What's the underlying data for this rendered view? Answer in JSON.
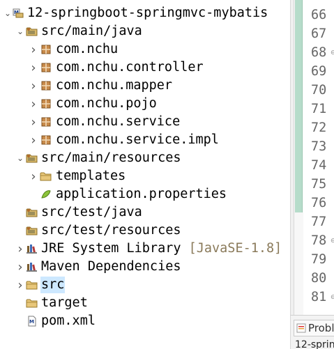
{
  "project_explorer": {
    "rows": [
      {
        "name": "project-root",
        "label": "12-springboot-springmvc-mybatis",
        "icon": "maven-project-icon",
        "expanded": true
      },
      {
        "name": "src-main-java",
        "label": "src/main/java",
        "icon": "source-folder-icon",
        "expanded": true
      },
      {
        "name": "pkg-com-nchu",
        "label": "com.nchu",
        "icon": "package-icon",
        "expanded": false
      },
      {
        "name": "pkg-controller",
        "label": "com.nchu.controller",
        "icon": "package-icon",
        "expanded": false
      },
      {
        "name": "pkg-mapper",
        "label": "com.nchu.mapper",
        "icon": "package-icon",
        "expanded": false
      },
      {
        "name": "pkg-pojo",
        "label": "com.nchu.pojo",
        "icon": "package-icon",
        "expanded": false
      },
      {
        "name": "pkg-service",
        "label": "com.nchu.service",
        "icon": "package-icon",
        "expanded": false
      },
      {
        "name": "pkg-service-impl",
        "label": "com.nchu.service.impl",
        "icon": "package-icon",
        "expanded": false
      },
      {
        "name": "src-main-resources",
        "label": "src/main/resources",
        "icon": "source-folder-icon",
        "expanded": true
      },
      {
        "name": "folder-templates",
        "label": "templates",
        "icon": "folder-icon",
        "expanded": false
      },
      {
        "name": "file-application-properties",
        "label": "application.properties",
        "icon": "properties-file-icon"
      },
      {
        "name": "src-test-java",
        "label": "src/test/java",
        "icon": "source-folder-icon"
      },
      {
        "name": "src-test-resources",
        "label": "src/test/resources",
        "icon": "source-folder-icon"
      },
      {
        "name": "jre-library",
        "label": "JRE System Library",
        "decoration": "[JavaSE-1.8]",
        "icon": "library-icon",
        "expanded": false
      },
      {
        "name": "maven-dependencies",
        "label": "Maven Dependencies",
        "icon": "library-icon",
        "expanded": false
      },
      {
        "name": "folder-src",
        "label": "src",
        "icon": "folder-icon",
        "expanded": false,
        "selected": true
      },
      {
        "name": "folder-target",
        "label": "target",
        "icon": "folder-icon"
      },
      {
        "name": "file-pom",
        "label": "pom.xml",
        "icon": "xml-file-icon"
      }
    ]
  },
  "editor": {
    "line_numbers": [
      "66",
      "67",
      "68",
      "69",
      "70",
      "71",
      "72",
      "73",
      "74",
      "75",
      "76",
      "77",
      "78",
      "79",
      "80",
      "81"
    ],
    "folded_lines": [
      "68",
      "78",
      "81"
    ]
  },
  "bottom_panel": {
    "tab_label": "Probl",
    "sub_label": "12-sprin"
  },
  "colors": {
    "selection": "#cde8ff",
    "ruler_bar": "#b6dcca",
    "decoration": "#8a7a5a"
  }
}
